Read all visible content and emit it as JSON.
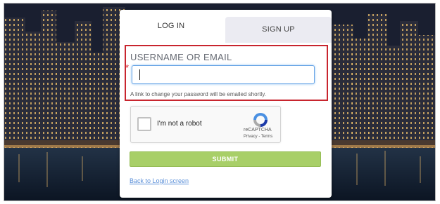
{
  "tabs": {
    "login_label": "LOG IN",
    "signup_label": "SIGN UP",
    "active": "login"
  },
  "form": {
    "field_label": "USERNAME OR EMAIL",
    "required_marker": "*",
    "field_value": "",
    "hint": "A link to change your password will be emailed shortly."
  },
  "captcha": {
    "label": "I'm not a robot",
    "brand": "reCAPTCHA",
    "links": "Privacy - Terms",
    "checked": false
  },
  "actions": {
    "submit_label": "SUBMIT",
    "back_label": "Back to Login screen"
  },
  "colors": {
    "highlight": "#c8252e",
    "submit": "#a8cf68",
    "link": "#5a8fd8",
    "input_focus": "#6aa6e6",
    "required": "#d9262f"
  },
  "icons": {
    "captcha_logo": "recaptcha-logo-icon",
    "background": "city-skyline-background"
  }
}
